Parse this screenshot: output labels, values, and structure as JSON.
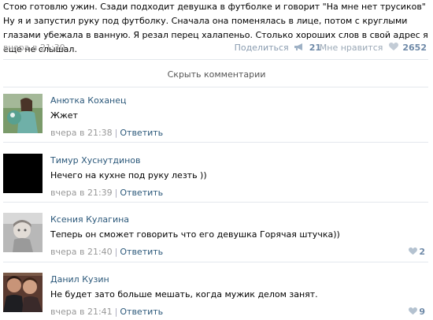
{
  "post": {
    "text": "Стою готовлю ужин. Сзади подходит девушка в футболке и говорит \"На мне нет трусиков\" Ну я и запустил руку под футболку. Сначала она поменялась в лице, потом с круглыми глазами убежала в ванную. Я резал перец халапеньо. Столько хороших слов в свой адрес я еще не слышал.",
    "time": "вчера в 21:30",
    "share_label": "Поделиться",
    "share_count": "21",
    "like_label": "Мне нравится",
    "like_count": "2652"
  },
  "hide_comments_label": "Скрыть комментарии",
  "reply_label": "Ответить",
  "comments": [
    {
      "name": "Анютка Коханец",
      "text": "Жжет",
      "time": "вчера в 21:38",
      "likes": ""
    },
    {
      "name": "Тимур Хуснутдинов",
      "text": "Нечего на кухне под руку лезть ))",
      "time": "вчера в 21:39",
      "likes": ""
    },
    {
      "name": "Ксения Кулагина",
      "text": "Теперь он сможет говорить что его девушка Горячая штучка))",
      "time": "вчера в 21:40",
      "likes": "2"
    },
    {
      "name": "Данил Кузин",
      "text": "Не будет зато больше мешать, когда мужик делом занят.",
      "time": "вчера в 21:41",
      "likes": "9"
    }
  ],
  "colors": {
    "link": "#2b587a",
    "muted": "#999999",
    "accent": "#6f8aa8",
    "divider": "#e4e8ed"
  },
  "icons": {
    "share": "megaphone-icon",
    "like": "heart-icon"
  }
}
